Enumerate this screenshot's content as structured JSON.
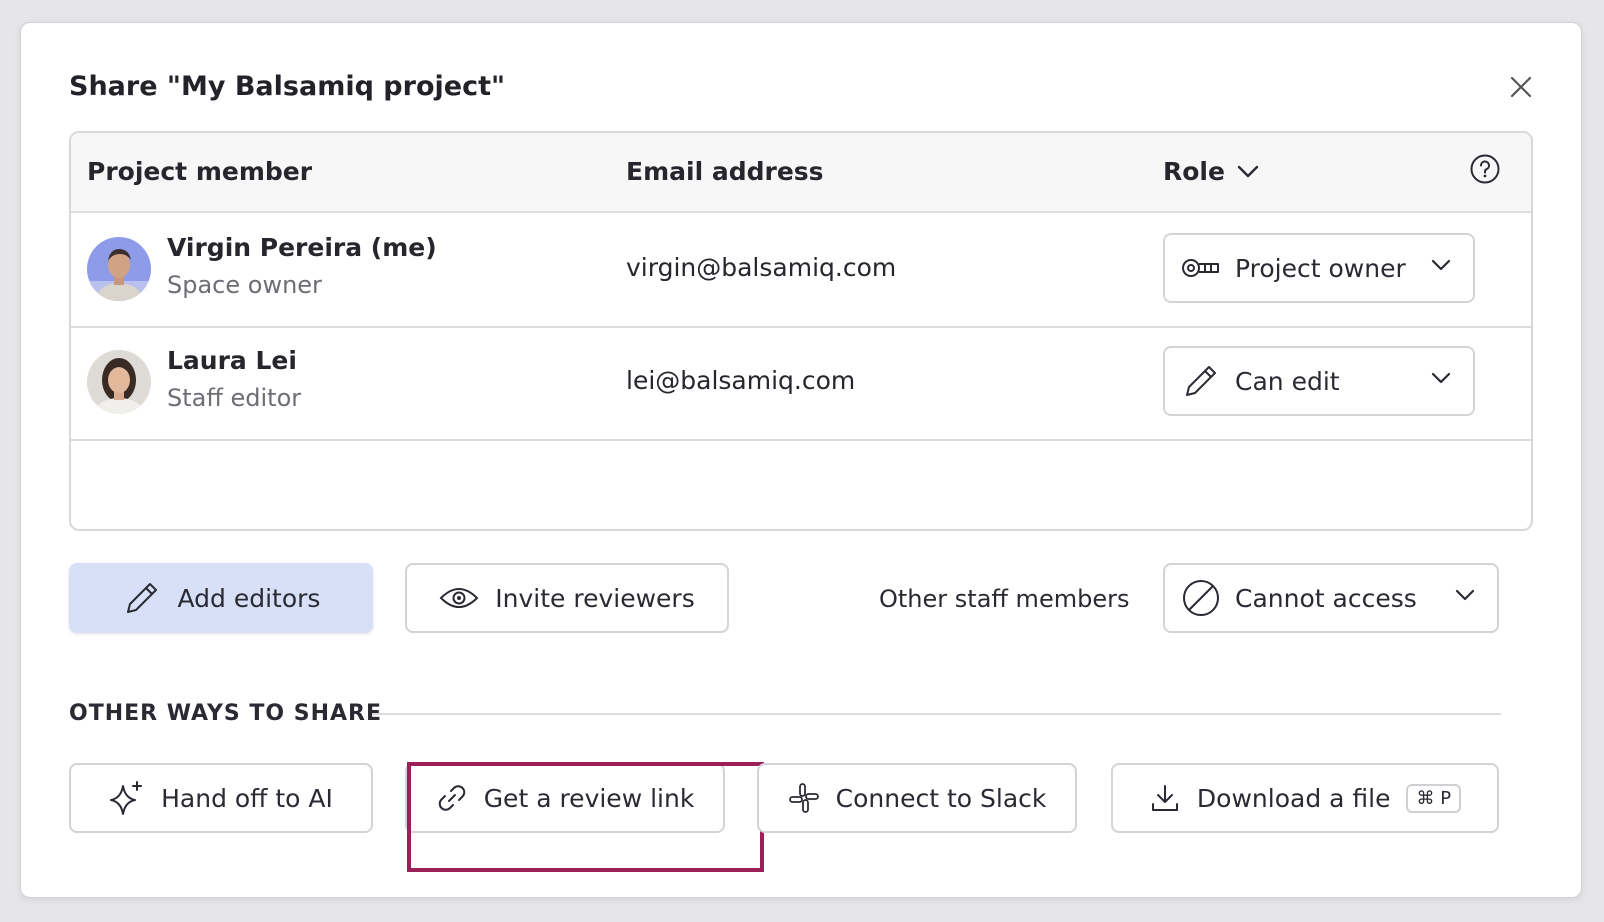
{
  "dialog": {
    "title": "Share \"My Balsamiq project\"",
    "close_icon": "close-icon"
  },
  "table": {
    "headers": {
      "member": "Project member",
      "email": "Email address",
      "role": "Role"
    },
    "help_icon": "question-circle-icon",
    "rows": [
      {
        "name": "Virgin Pereira (me)",
        "subtitle": "Space owner",
        "email": "virgin@balsamiq.com",
        "role": "Project owner",
        "role_icon": "key-icon"
      },
      {
        "name": "Laura Lei",
        "subtitle": "Staff editor",
        "email": "lei@balsamiq.com",
        "role": "Can edit",
        "role_icon": "pencil-icon"
      }
    ]
  },
  "actions": {
    "add_editors": "Add editors",
    "invite_reviewers": "Invite reviewers",
    "other_staff_label": "Other staff members",
    "staff_access": "Cannot access"
  },
  "other_ways": {
    "heading": "OTHER WAYS TO SHARE",
    "hand_off": "Hand off to AI",
    "review_link": "Get a review link",
    "connect_slack": "Connect to Slack",
    "download": "Download a file",
    "download_shortcut": "⌘ P"
  },
  "colors": {
    "primary_button_bg": "#d8e0f7",
    "highlight_border": "#9c2058",
    "background": "#e6e6e8"
  }
}
